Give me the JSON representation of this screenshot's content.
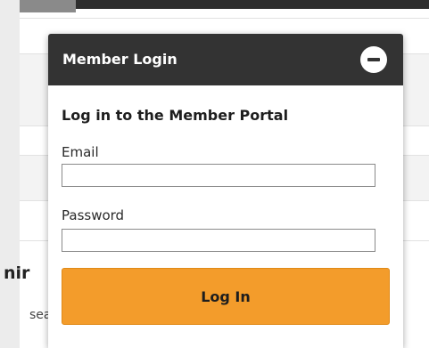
{
  "background": {
    "heading_fragment": "nir",
    "text_fragment": "sea"
  },
  "login_panel": {
    "title": "Member Login",
    "heading": "Log in to the Member Portal",
    "email_label": "Email",
    "email_value": "",
    "password_label": "Password",
    "password_value": "",
    "submit_label": "Log In"
  },
  "colors": {
    "header_bg": "#333333",
    "button_bg": "#f39c2b"
  },
  "icons": {
    "collapse": "minus-circle-icon"
  }
}
